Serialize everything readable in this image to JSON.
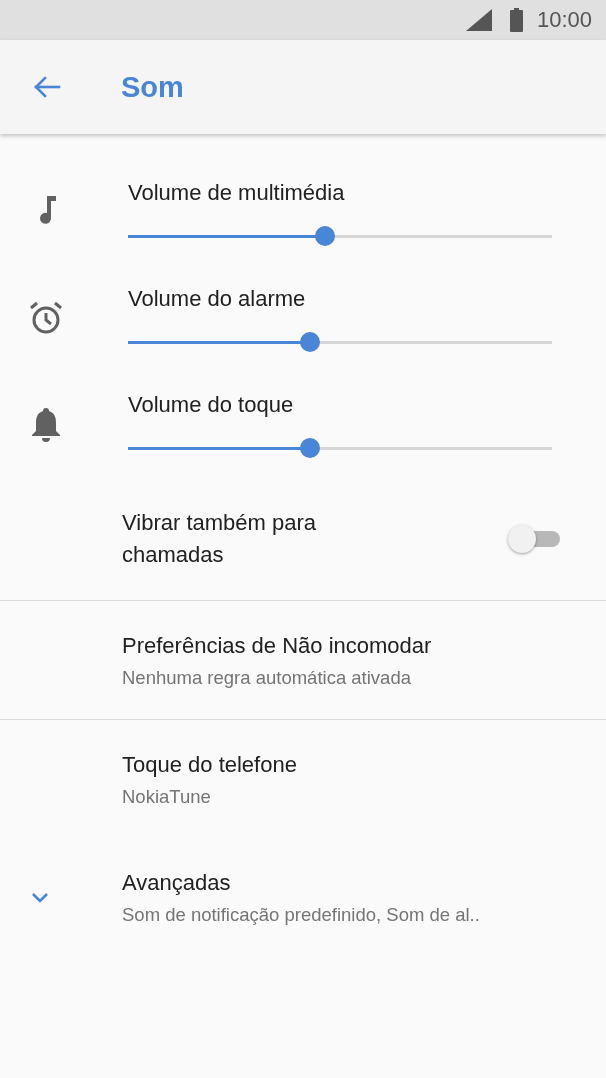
{
  "status_bar": {
    "time": "10:00"
  },
  "app_bar": {
    "title": "Som"
  },
  "volume_sliders": [
    {
      "label": "Volume de multimédia",
      "level": 0.465
    },
    {
      "label": "Volume do alarme",
      "level": 0.43
    },
    {
      "label": "Volume do toque",
      "level": 0.43
    }
  ],
  "vibrate_switch": {
    "label": "Vibrar também para chamadas",
    "on": false
  },
  "preferences": [
    {
      "title": "Preferências de Não incomodar",
      "subtitle": "Nenhuma regra automática ativada",
      "divider_after": true,
      "expandable": false
    },
    {
      "title": "Toque do telefone",
      "subtitle": "NokiaTune",
      "divider_after": false,
      "expandable": false
    },
    {
      "title": "Avançadas",
      "subtitle": "Som de notificação predefinido, Som de al..",
      "divider_after": false,
      "expandable": true,
      "expanded": false
    }
  ]
}
